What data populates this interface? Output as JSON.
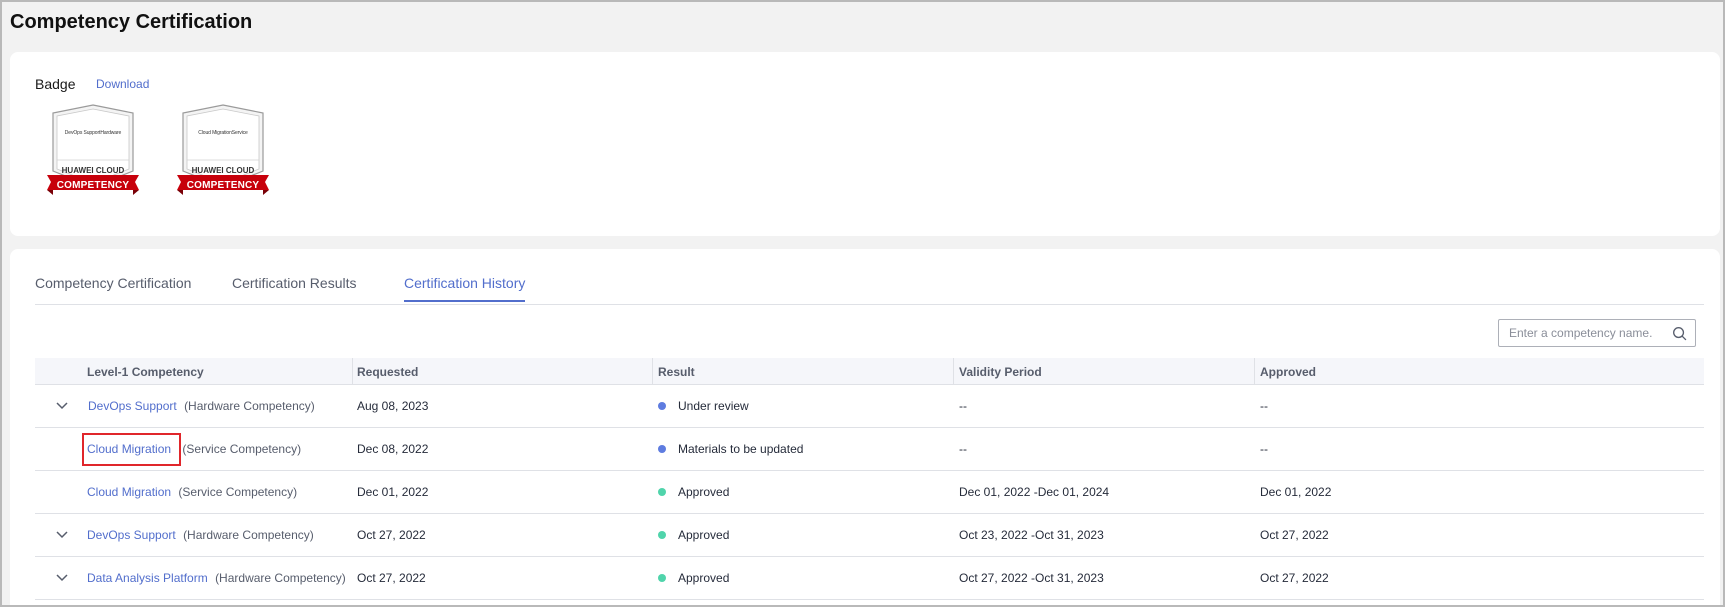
{
  "page": {
    "title": "Competency Certification"
  },
  "badge_section": {
    "label": "Badge",
    "download": "Download",
    "badges": [
      {
        "text": "DevOps SupportHardware",
        "brand": "HUAWEI CLOUD",
        "ribbon": "COMPETENCY"
      },
      {
        "text": "Cloud MigrationService",
        "brand": "HUAWEI CLOUD",
        "ribbon": "COMPETENCY"
      }
    ]
  },
  "tabs": [
    {
      "label": "Competency Certification",
      "active": false
    },
    {
      "label": "Certification Results",
      "active": false
    },
    {
      "label": "Certification History",
      "active": true
    }
  ],
  "search": {
    "placeholder": "Enter a competency name."
  },
  "table": {
    "headers": [
      "Level-1 Competency",
      "Requested",
      "Result",
      "Validity Period",
      "Approved"
    ],
    "rows": [
      {
        "expandable": true,
        "name": "DevOps Support",
        "type": "(Hardware Competency)",
        "requested": "Aug 08, 2023",
        "result": "Under review",
        "result_color": "#5e7ce0",
        "validity": "--",
        "approved": "--",
        "highlighted": false
      },
      {
        "expandable": false,
        "name": "Cloud Migration",
        "type": "(Service Competency)",
        "requested": "Dec 08, 2022",
        "result": "Materials to be updated",
        "result_color": "#5e7ce0",
        "validity": "--",
        "approved": "--",
        "highlighted": true
      },
      {
        "expandable": false,
        "name": "Cloud Migration",
        "type": "(Service Competency)",
        "requested": "Dec 01, 2022",
        "result": "Approved",
        "result_color": "#50d4ab",
        "validity": "Dec 01, 2022 -Dec 01, 2024",
        "approved": "Dec 01, 2022",
        "highlighted": false
      },
      {
        "expandable": true,
        "name": "DevOps Support",
        "type": "(Hardware Competency)",
        "requested": "Oct 27, 2022",
        "result": "Approved",
        "result_color": "#50d4ab",
        "validity": "Oct 23, 2022 -Oct 31, 2023",
        "approved": "Oct 27, 2022",
        "highlighted": false
      },
      {
        "expandable": true,
        "name": "Data Analysis Platform",
        "type": "(Hardware Competency)",
        "requested": "Oct 27, 2022",
        "result": "Approved",
        "result_color": "#50d4ab",
        "validity": "Oct 27, 2022 -Oct 31, 2023",
        "approved": "Oct 27, 2022",
        "highlighted": false
      }
    ]
  }
}
